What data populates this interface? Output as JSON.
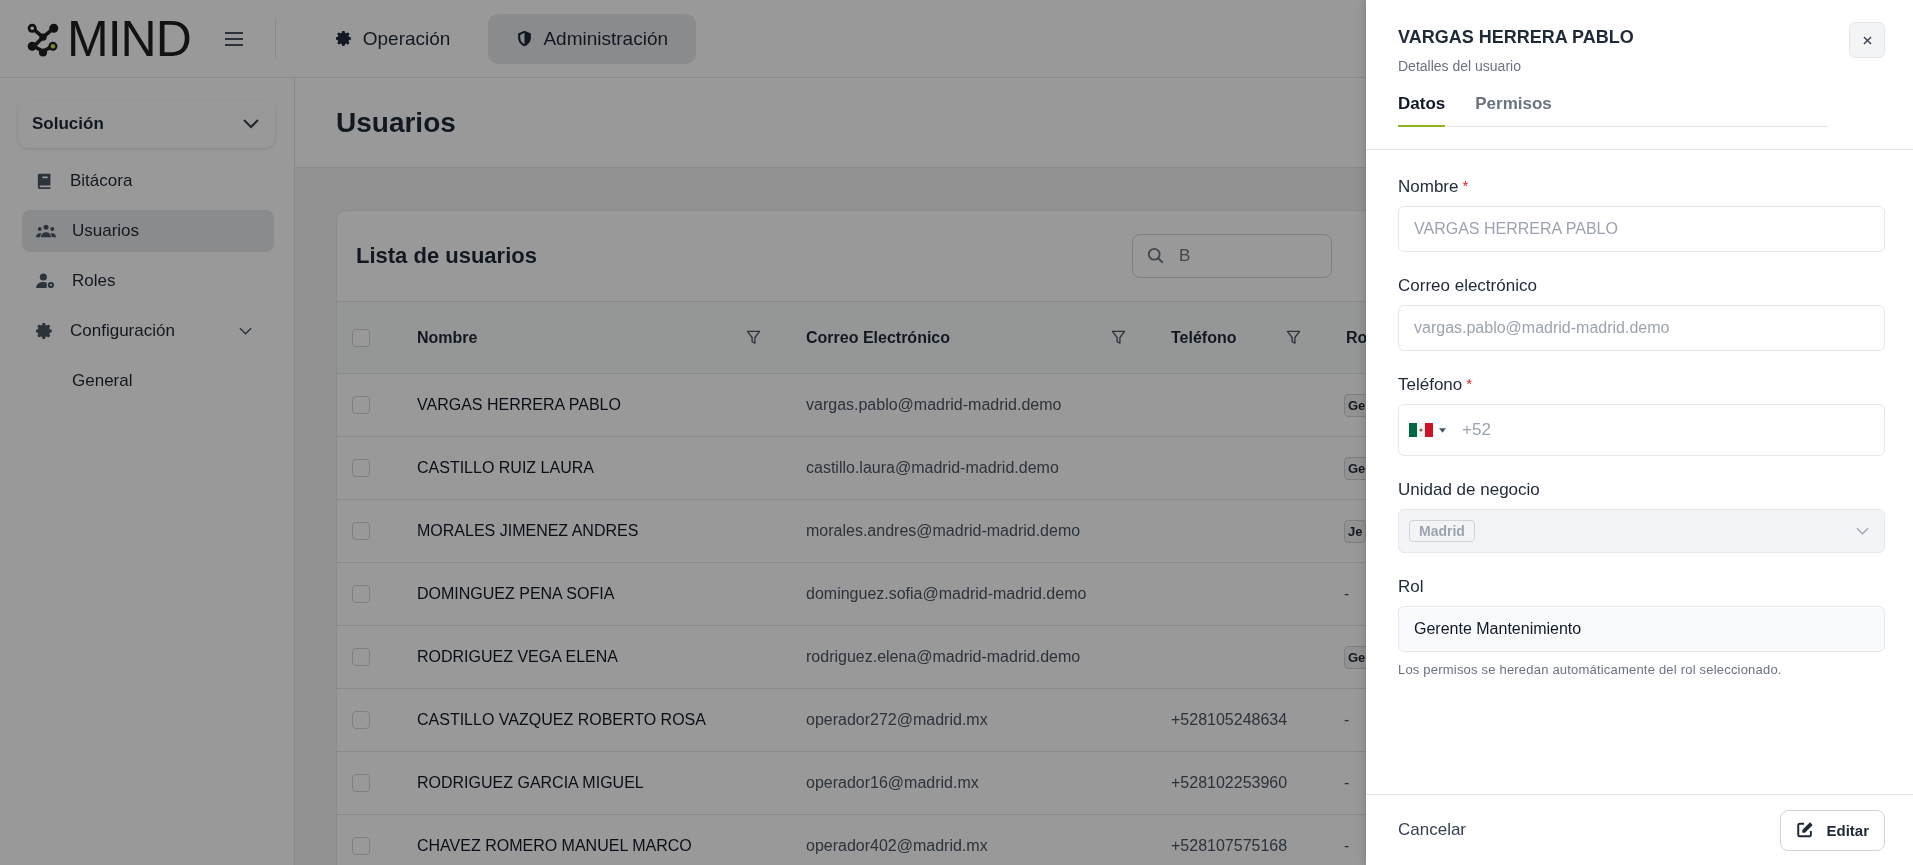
{
  "dimmed": true,
  "header": {
    "logo": "MIND",
    "nav": [
      {
        "label": "Operación",
        "selected": false
      },
      {
        "label": "Administración",
        "selected": true
      }
    ]
  },
  "sidebar": {
    "section": {
      "label": "Solución",
      "expanded": true
    },
    "items": [
      {
        "label": "Bitácora",
        "selected": false
      },
      {
        "label": "Usuarios",
        "selected": true
      },
      {
        "label": "Roles",
        "selected": false
      },
      {
        "label": "Configuración",
        "selected": false,
        "expanded": true,
        "children": [
          {
            "label": "General",
            "selected": false
          }
        ]
      }
    ]
  },
  "page_title": "Usuarios",
  "table": {
    "title": "Lista de usuarios",
    "search": {
      "placeholder": "B"
    },
    "header_checked": false,
    "columns": [
      {
        "label": "Nombre",
        "filter": true
      },
      {
        "label": "Correo Electrónico",
        "filter": true
      },
      {
        "label": "Teléfono",
        "filter": true
      },
      {
        "label": "Ro"
      }
    ],
    "rows": [
      {
        "checked": false,
        "nombre": "VARGAS HERRERA PABLO",
        "correo": "vargas.pablo@madrid-madrid.demo",
        "rol": {
          "kind": "tag",
          "text": "Ge"
        }
      },
      {
        "checked": false,
        "nombre": "CASTILLO RUIZ LAURA",
        "correo": "castillo.laura@madrid-madrid.demo",
        "rol": {
          "kind": "tag",
          "text": "Ge"
        }
      },
      {
        "checked": false,
        "nombre": "MORALES JIMENEZ ANDRES",
        "correo": "morales.andres@madrid-madrid.demo",
        "rol": {
          "kind": "tag",
          "text": "Je"
        }
      },
      {
        "checked": false,
        "nombre": "DOMINGUEZ PENA SOFIA",
        "correo": "dominguez.sofia@madrid-madrid.demo",
        "rol": {
          "kind": "plain",
          "text": "-"
        }
      },
      {
        "checked": false,
        "nombre": "RODRIGUEZ VEGA ELENA",
        "correo": "rodriguez.elena@madrid-madrid.demo",
        "rol": {
          "kind": "tag",
          "text": "Ge"
        }
      },
      {
        "checked": false,
        "nombre": "CASTILLO VAZQUEZ ROBERTO ROSA",
        "correo": "operador272@madrid.mx",
        "telefono": "+528105248634",
        "rol": {
          "kind": "plain",
          "text": "-"
        }
      },
      {
        "checked": false,
        "nombre": "RODRIGUEZ GARCIA MIGUEL",
        "correo": "operador16@madrid.mx",
        "telefono": "+528102253960",
        "rol": {
          "kind": "plain",
          "text": "-"
        }
      },
      {
        "checked": false,
        "nombre": "CHAVEZ ROMERO MANUEL MARCO",
        "correo": "operador402@madrid.mx",
        "telefono": "+528107575168",
        "rol": {
          "kind": "plain",
          "text": "-"
        }
      }
    ]
  },
  "drawer": {
    "title": "VARGAS HERRERA PABLO",
    "subtitle": "Detalles del usuario",
    "tabs": [
      {
        "label": "Datos",
        "selected": true
      },
      {
        "label": "Permisos",
        "selected": false
      }
    ],
    "fields": [
      {
        "kind": "text",
        "label": "Nombre",
        "required_mark": "*",
        "value": "VARGAS HERRERA PABLO",
        "disabled": true
      },
      {
        "kind": "text",
        "label": "Correo electrónico",
        "value": "vargas.pablo@madrid-madrid.demo",
        "disabled": true
      },
      {
        "kind": "phone",
        "label": "Teléfono",
        "required_mark": "*",
        "value": "+52",
        "disabled": true
      },
      {
        "kind": "select",
        "label": "Unidad de negocio",
        "tags": [
          "Madrid"
        ],
        "disabled": true
      },
      {
        "kind": "text",
        "label": "Rol",
        "value": "Gerente Mantenimiento",
        "disabled": false,
        "help": "Los permisos se heredan automáticamente del rol seleccionado."
      }
    ],
    "footer": {
      "cancel": "Cancelar",
      "submit": "Editar"
    }
  }
}
